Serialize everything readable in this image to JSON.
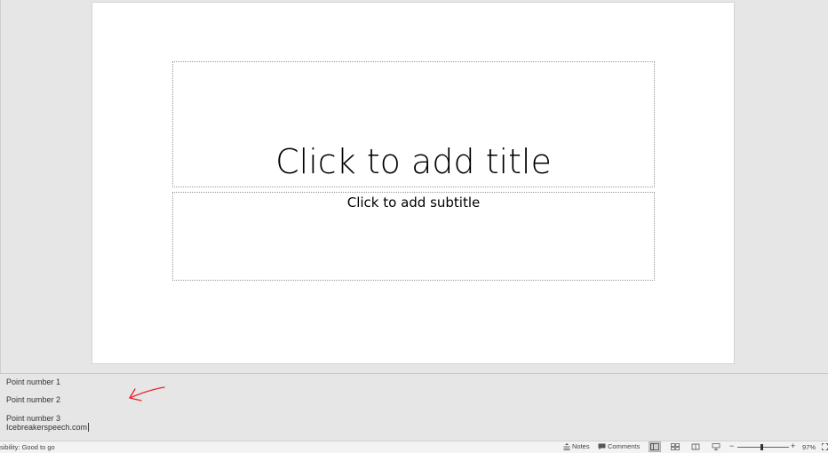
{
  "slide": {
    "title_placeholder": "Click to add title",
    "subtitle_placeholder": "Click to add subtitle"
  },
  "notes": {
    "lines": [
      "Point number 1",
      "Point number 2",
      "Point number 3",
      "Icebreakerspeech.com"
    ]
  },
  "annotation": {
    "color": "#e8202a",
    "icon": "arrow-icon"
  },
  "statusbar": {
    "accessibility": "sibility: Good to go",
    "notes_label": "Notes",
    "comments_label": "Comments",
    "zoom_minus": "−",
    "zoom_plus": "+",
    "zoom_level": "97%"
  }
}
